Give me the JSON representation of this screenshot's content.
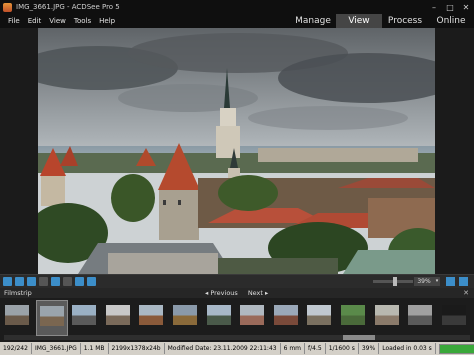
{
  "window": {
    "title": "IMG_3661.JPG - ACDSee Pro 5",
    "min_glyph": "–",
    "max_glyph": "□",
    "close_glyph": "✕"
  },
  "menu": [
    "File",
    "Edit",
    "View",
    "Tools",
    "Help"
  ],
  "modes": [
    {
      "label": "Manage",
      "active": false
    },
    {
      "label": "View",
      "active": true
    },
    {
      "label": "Process",
      "active": false
    },
    {
      "label": "Online",
      "active": false
    }
  ],
  "toolbar": {
    "icons": [
      "nav-back-icon",
      "nav-forward-icon",
      "rotate-left-icon",
      "rotate-right-icon",
      "flip-icon",
      "save-icon",
      "info-icon",
      "fit-icon"
    ],
    "zoom_value": "39%",
    "zoom_level": 0.55
  },
  "filmstrip": {
    "label": "Filmstrip",
    "previous": "◂ Previous",
    "next": "Next ▸",
    "close": "✕",
    "selected_index": 1,
    "thumbs": [
      {
        "name": "thumb-1",
        "sky": "#9aa2a8",
        "ground": "#6a5a4a"
      },
      {
        "name": "thumb-2",
        "sky": "#9aa4ac",
        "ground": "#7a6650"
      },
      {
        "name": "thumb-3",
        "sky": "#9ab0c4",
        "ground": "#5a5a5a"
      },
      {
        "name": "thumb-4",
        "sky": "#c8c8c8",
        "ground": "#7a6a5a"
      },
      {
        "name": "thumb-5",
        "sky": "#aab8c4",
        "ground": "#8a5a3a"
      },
      {
        "name": "thumb-6",
        "sky": "#8a9aaa",
        "ground": "#8a6a3a"
      },
      {
        "name": "thumb-7",
        "sky": "#a8b8c8",
        "ground": "#4a5a4a"
      },
      {
        "name": "thumb-8",
        "sky": "#b0b8c0",
        "ground": "#9a6a5a"
      },
      {
        "name": "thumb-9",
        "sky": "#9aa8b8",
        "ground": "#7a4a3a"
      },
      {
        "name": "thumb-10",
        "sky": "#c0c8d0",
        "ground": "#7a7060"
      },
      {
        "name": "thumb-11",
        "sky": "#5a8a4a",
        "ground": "#4a6a3a"
      },
      {
        "name": "thumb-12",
        "sky": "#b8b8b0",
        "ground": "#8a7a6a"
      },
      {
        "name": "thumb-13",
        "sky": "#a0a0a0",
        "ground": "#5a5a5a"
      },
      {
        "name": "thumb-14",
        "sky": "#1a1a1a",
        "ground": "#3a3a3a"
      }
    ],
    "scroll_position": 0.78
  },
  "status": {
    "position": "192/242",
    "filename": "IMG_3661.JPG",
    "filesize": "1.1 MB",
    "dimensions": "2199x1378x24b",
    "modified": "Modified Date: 23.11.2009 22:11:43",
    "focal": "6 mm",
    "aperture": "f/4.5",
    "shutter": "1/1600 s",
    "zoom": "39%",
    "loaded": "Loaded in 0.03 s",
    "progress": 1.0
  }
}
